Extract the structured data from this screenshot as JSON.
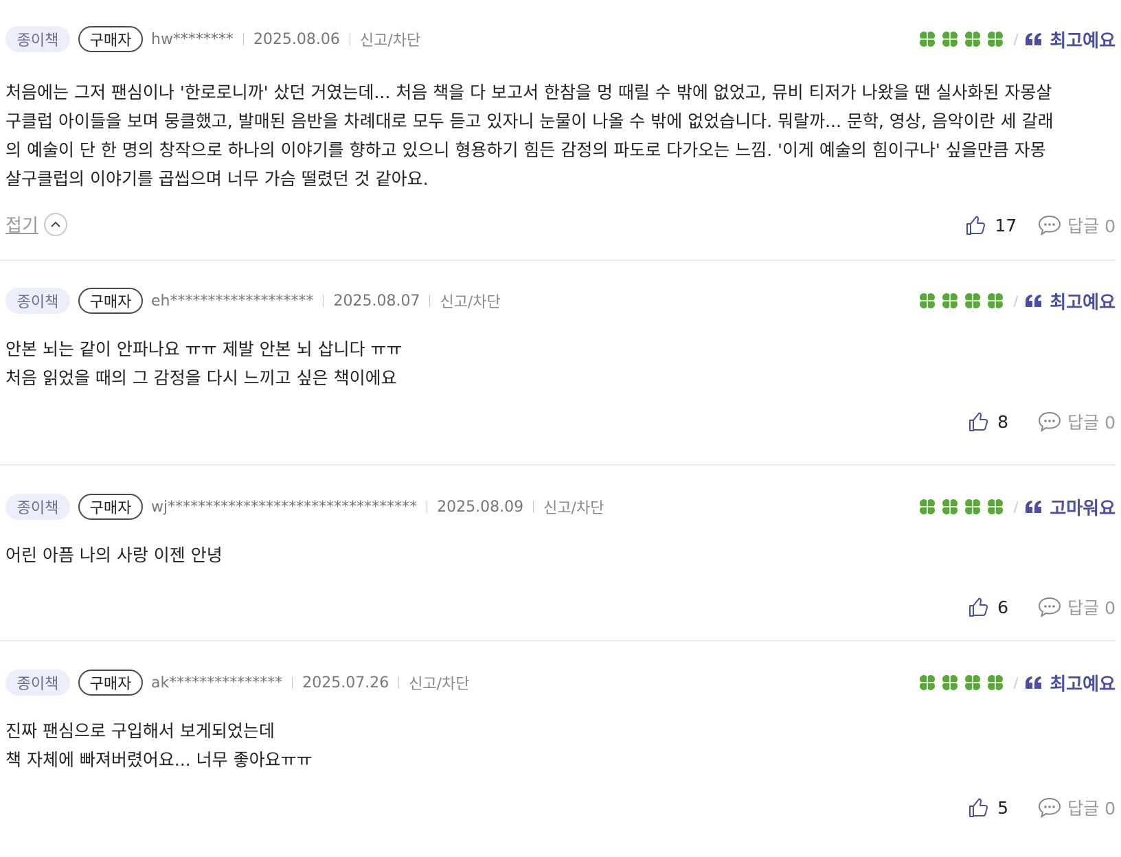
{
  "reviews": [
    {
      "format": "종이책",
      "buyer": "구매자",
      "user": "hw********",
      "date": "2025.08.06",
      "report": "신고/차단",
      "stars": 4,
      "emotion": "최고예요",
      "text": "처음에는 그저 팬심이나 '한로로니까' 샀던 거였는데... 처음 책을 다 보고서 한참을 멍 때릴 수 밖에 없었고, 뮤비 티저가 나왔을 땐 실사화된 자몽살구클럽 아이들을 보며 뭉클했고, 발매된 음반을 차례대로 모두 듣고 있자니 눈물이 나올 수 밖에 없었습니다. 뭐랄까... 문학, 영상, 음악이란 세 갈래의 예술이 단 한 명의 창작으로 하나의 이야기를 향하고 있으니 형용하기 힘든 감정의 파도로 다가오는 느낌. '이게 예술의 힘이구나' 싶을만큼 자몽살구클럽의 이야기를 곱씹으며 너무 가슴 떨렸던 것 같아요.",
      "fold": "접기",
      "likes": "17",
      "reply": "답글 0"
    },
    {
      "format": "종이책",
      "buyer": "구매자",
      "user": "eh*******************",
      "date": "2025.08.07",
      "report": "신고/차단",
      "stars": 4,
      "emotion": "최고예요",
      "text": "안본 뇌는 같이 안파나요 ㅠㅠ 제발 안본 뇌 삽니다 ㅠㅠ\n처음 읽었을 때의 그 감정을 다시 느끼고 싶은 책이에요",
      "likes": "8",
      "reply": "답글 0"
    },
    {
      "format": "종이책",
      "buyer": "구매자",
      "user": "wj*********************************",
      "date": "2025.08.09",
      "report": "신고/차단",
      "stars": 4,
      "emotion": "고마워요",
      "text": "어린 아픔 나의 사랑 이젠 안녕",
      "likes": "6",
      "reply": "답글 0"
    },
    {
      "format": "종이책",
      "buyer": "구매자",
      "user": "ak***************",
      "date": "2025.07.26",
      "report": "신고/차단",
      "stars": 4,
      "emotion": "최고예요",
      "text": "진짜 팬심으로 구입해서 보게되었는데\n책 자체에 빠져버렸어요... 너무 좋아요ㅠㅠ",
      "likes": "5",
      "reply": "답글 0"
    }
  ],
  "colors": {
    "clover": "#5aa83a",
    "emotion": "#4a4fa0",
    "format_badge_bg": "#eceef9"
  },
  "icons": {
    "rating": "clover-icon",
    "emotion": "quote-icon",
    "like": "thumbs-up-icon",
    "reply": "speech-bubble-icon",
    "fold": "chevron-up-icon"
  }
}
